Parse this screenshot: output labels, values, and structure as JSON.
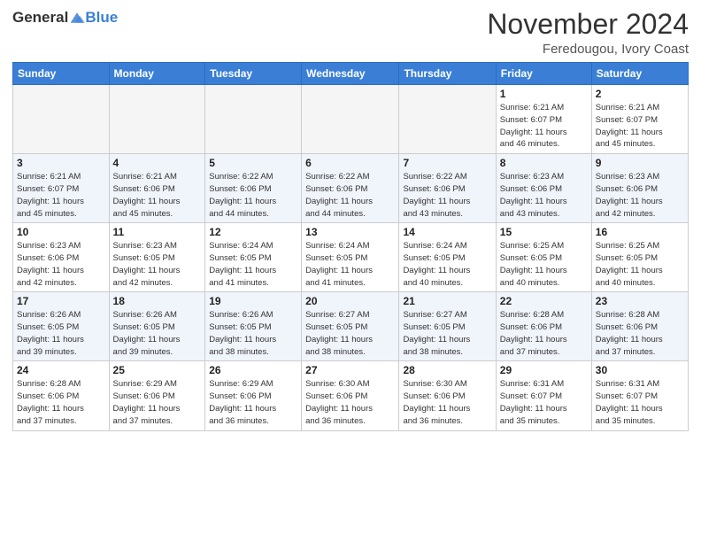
{
  "logo": {
    "general": "General",
    "blue": "Blue"
  },
  "title": "November 2024",
  "location": "Feredougou, Ivory Coast",
  "days_header": [
    "Sunday",
    "Monday",
    "Tuesday",
    "Wednesday",
    "Thursday",
    "Friday",
    "Saturday"
  ],
  "weeks": [
    [
      {
        "day": "",
        "info": ""
      },
      {
        "day": "",
        "info": ""
      },
      {
        "day": "",
        "info": ""
      },
      {
        "day": "",
        "info": ""
      },
      {
        "day": "",
        "info": ""
      },
      {
        "day": "1",
        "info": "Sunrise: 6:21 AM\nSunset: 6:07 PM\nDaylight: 11 hours\nand 46 minutes."
      },
      {
        "day": "2",
        "info": "Sunrise: 6:21 AM\nSunset: 6:07 PM\nDaylight: 11 hours\nand 45 minutes."
      }
    ],
    [
      {
        "day": "3",
        "info": "Sunrise: 6:21 AM\nSunset: 6:07 PM\nDaylight: 11 hours\nand 45 minutes."
      },
      {
        "day": "4",
        "info": "Sunrise: 6:21 AM\nSunset: 6:06 PM\nDaylight: 11 hours\nand 45 minutes."
      },
      {
        "day": "5",
        "info": "Sunrise: 6:22 AM\nSunset: 6:06 PM\nDaylight: 11 hours\nand 44 minutes."
      },
      {
        "day": "6",
        "info": "Sunrise: 6:22 AM\nSunset: 6:06 PM\nDaylight: 11 hours\nand 44 minutes."
      },
      {
        "day": "7",
        "info": "Sunrise: 6:22 AM\nSunset: 6:06 PM\nDaylight: 11 hours\nand 43 minutes."
      },
      {
        "day": "8",
        "info": "Sunrise: 6:23 AM\nSunset: 6:06 PM\nDaylight: 11 hours\nand 43 minutes."
      },
      {
        "day": "9",
        "info": "Sunrise: 6:23 AM\nSunset: 6:06 PM\nDaylight: 11 hours\nand 42 minutes."
      }
    ],
    [
      {
        "day": "10",
        "info": "Sunrise: 6:23 AM\nSunset: 6:06 PM\nDaylight: 11 hours\nand 42 minutes."
      },
      {
        "day": "11",
        "info": "Sunrise: 6:23 AM\nSunset: 6:05 PM\nDaylight: 11 hours\nand 42 minutes."
      },
      {
        "day": "12",
        "info": "Sunrise: 6:24 AM\nSunset: 6:05 PM\nDaylight: 11 hours\nand 41 minutes."
      },
      {
        "day": "13",
        "info": "Sunrise: 6:24 AM\nSunset: 6:05 PM\nDaylight: 11 hours\nand 41 minutes."
      },
      {
        "day": "14",
        "info": "Sunrise: 6:24 AM\nSunset: 6:05 PM\nDaylight: 11 hours\nand 40 minutes."
      },
      {
        "day": "15",
        "info": "Sunrise: 6:25 AM\nSunset: 6:05 PM\nDaylight: 11 hours\nand 40 minutes."
      },
      {
        "day": "16",
        "info": "Sunrise: 6:25 AM\nSunset: 6:05 PM\nDaylight: 11 hours\nand 40 minutes."
      }
    ],
    [
      {
        "day": "17",
        "info": "Sunrise: 6:26 AM\nSunset: 6:05 PM\nDaylight: 11 hours\nand 39 minutes."
      },
      {
        "day": "18",
        "info": "Sunrise: 6:26 AM\nSunset: 6:05 PM\nDaylight: 11 hours\nand 39 minutes."
      },
      {
        "day": "19",
        "info": "Sunrise: 6:26 AM\nSunset: 6:05 PM\nDaylight: 11 hours\nand 38 minutes."
      },
      {
        "day": "20",
        "info": "Sunrise: 6:27 AM\nSunset: 6:05 PM\nDaylight: 11 hours\nand 38 minutes."
      },
      {
        "day": "21",
        "info": "Sunrise: 6:27 AM\nSunset: 6:05 PM\nDaylight: 11 hours\nand 38 minutes."
      },
      {
        "day": "22",
        "info": "Sunrise: 6:28 AM\nSunset: 6:06 PM\nDaylight: 11 hours\nand 37 minutes."
      },
      {
        "day": "23",
        "info": "Sunrise: 6:28 AM\nSunset: 6:06 PM\nDaylight: 11 hours\nand 37 minutes."
      }
    ],
    [
      {
        "day": "24",
        "info": "Sunrise: 6:28 AM\nSunset: 6:06 PM\nDaylight: 11 hours\nand 37 minutes."
      },
      {
        "day": "25",
        "info": "Sunrise: 6:29 AM\nSunset: 6:06 PM\nDaylight: 11 hours\nand 37 minutes."
      },
      {
        "day": "26",
        "info": "Sunrise: 6:29 AM\nSunset: 6:06 PM\nDaylight: 11 hours\nand 36 minutes."
      },
      {
        "day": "27",
        "info": "Sunrise: 6:30 AM\nSunset: 6:06 PM\nDaylight: 11 hours\nand 36 minutes."
      },
      {
        "day": "28",
        "info": "Sunrise: 6:30 AM\nSunset: 6:06 PM\nDaylight: 11 hours\nand 36 minutes."
      },
      {
        "day": "29",
        "info": "Sunrise: 6:31 AM\nSunset: 6:07 PM\nDaylight: 11 hours\nand 35 minutes."
      },
      {
        "day": "30",
        "info": "Sunrise: 6:31 AM\nSunset: 6:07 PM\nDaylight: 11 hours\nand 35 minutes."
      }
    ]
  ]
}
